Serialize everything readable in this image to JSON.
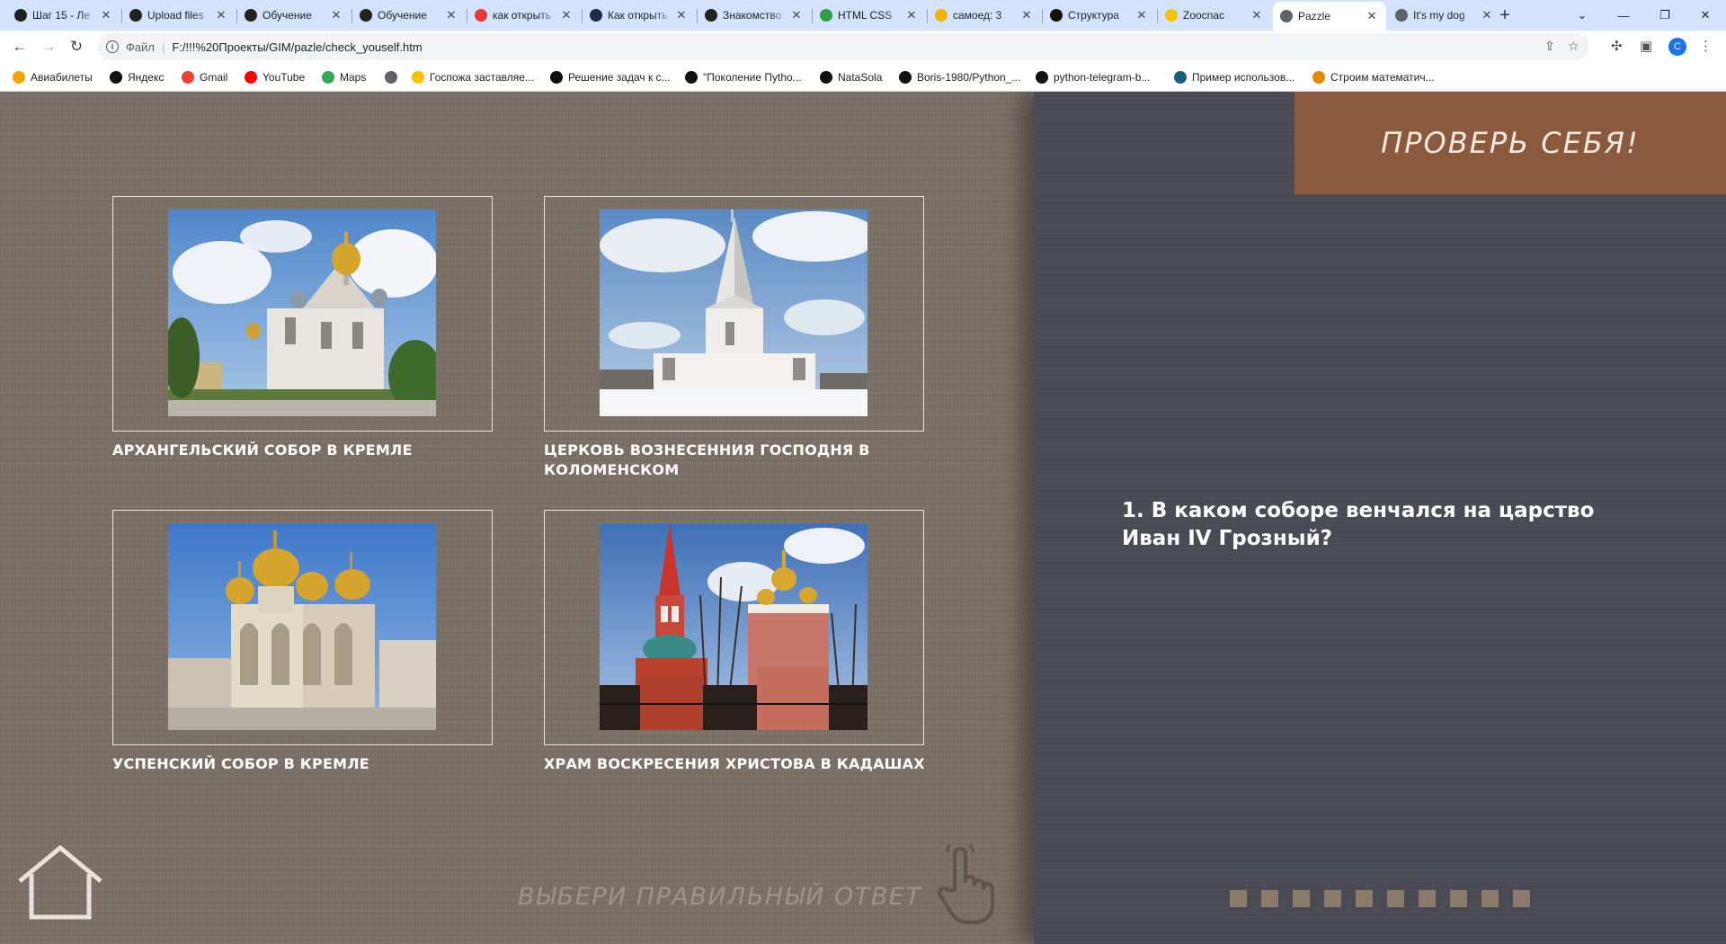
{
  "browser": {
    "tabs": [
      {
        "title": "Шаг 15 - Ле",
        "icon": "stepik-icon",
        "color": "#222"
      },
      {
        "title": "Upload files",
        "icon": "github-icon",
        "color": "#222"
      },
      {
        "title": "Обучение",
        "icon": "openai-icon",
        "color": "#222"
      },
      {
        "title": "Обучение",
        "icon": "openai-icon",
        "color": "#222"
      },
      {
        "title": "как открыть",
        "icon": "yandex-icon",
        "color": "#e53935"
      },
      {
        "title": "Как открыть",
        "icon": "k-icon",
        "color": "#1e2a4a"
      },
      {
        "title": "Знакомство",
        "icon": "media-icon",
        "color": "#222"
      },
      {
        "title": "HTML CSS",
        "icon": "check-icon",
        "color": "#2ea043"
      },
      {
        "title": "самоед: 3",
        "icon": "image-icon",
        "color": "#f0b400"
      },
      {
        "title": "Структура",
        "icon": "m-icon",
        "color": "#111"
      },
      {
        "title": "Zoocnac",
        "icon": "zoo-icon",
        "color": "#f4c300"
      },
      {
        "title": "Pazzle",
        "icon": "globe-icon",
        "color": "#5f6368"
      },
      {
        "title": "It's my dog",
        "icon": "globe-icon",
        "color": "#5f6368"
      }
    ],
    "active_tab_index": 11,
    "address": {
      "scheme": "Файл",
      "url": "F:/!!!%20Проекты/GIM/pazle/check_youself.htm"
    },
    "bookmarks": [
      {
        "label": "Авиабилеты",
        "icon": "plane-icon",
        "color": "#f4a300"
      },
      {
        "label": "Яндекс",
        "icon": "yandex-icon",
        "color": "#111"
      },
      {
        "label": "Gmail",
        "icon": "gmail-icon",
        "color": "#ea4335"
      },
      {
        "label": "YouTube",
        "icon": "youtube-icon",
        "color": "#ff0000"
      },
      {
        "label": "Maps",
        "icon": "maps-icon",
        "color": "#34a853"
      },
      {
        "label": "",
        "icon": "globe-icon",
        "color": "#5f6368"
      },
      {
        "label": "Госпожа заставляе...",
        "icon": "play-icon",
        "color": "#f4c300"
      },
      {
        "label": "Решение задач к с...",
        "icon": "github-icon",
        "color": "#111"
      },
      {
        "label": "\"Поколение Пytho...",
        "icon": "stepik-icon",
        "color": "#111"
      },
      {
        "label": "NataSola",
        "icon": "github-icon",
        "color": "#111"
      },
      {
        "label": "Boris-1980/Python_...",
        "icon": "github-icon",
        "color": "#111"
      },
      {
        "label": "python-telegram-b...",
        "icon": "github-icon",
        "color": "#111"
      },
      {
        "label": "Пример использов...",
        "icon": "book-icon",
        "color": "#1e5a7a"
      },
      {
        "label": "Строим математич...",
        "icon": "math-icon",
        "color": "#e08a00"
      }
    ],
    "profile_letter": "C"
  },
  "quiz": {
    "title": "ПРОВЕРЬ СЕБЯ!",
    "question": "1. В каком соборе венчался на царство Иван IV Грозный?",
    "hint": "ВЫБЕРИ ПРАВИЛЬНЫЙ ОТВЕТ",
    "answers": [
      {
        "caption": "АРХАНГЕЛЬСКИЙ СОБОР В КРЕМЛЕ"
      },
      {
        "caption": "ЦЕРКОВЬ ВОЗНЕСЕННИЯ ГОСПОДНЯ В КОЛОМЕНСКОМ"
      },
      {
        "caption": "УСПЕНСКИЙ СОБОР В КРЕМЛЕ"
      },
      {
        "caption": "ХРАМ ВОСКРЕСЕНИЯ ХРИСТОВА В КАДАШАХ"
      }
    ],
    "progress_total": 10,
    "colors": {
      "left_bg": "#7a7065",
      "right_bg": "#4a4a55",
      "title_bg": "#8b5a3c",
      "progress_square": "#8c7a6a"
    }
  }
}
